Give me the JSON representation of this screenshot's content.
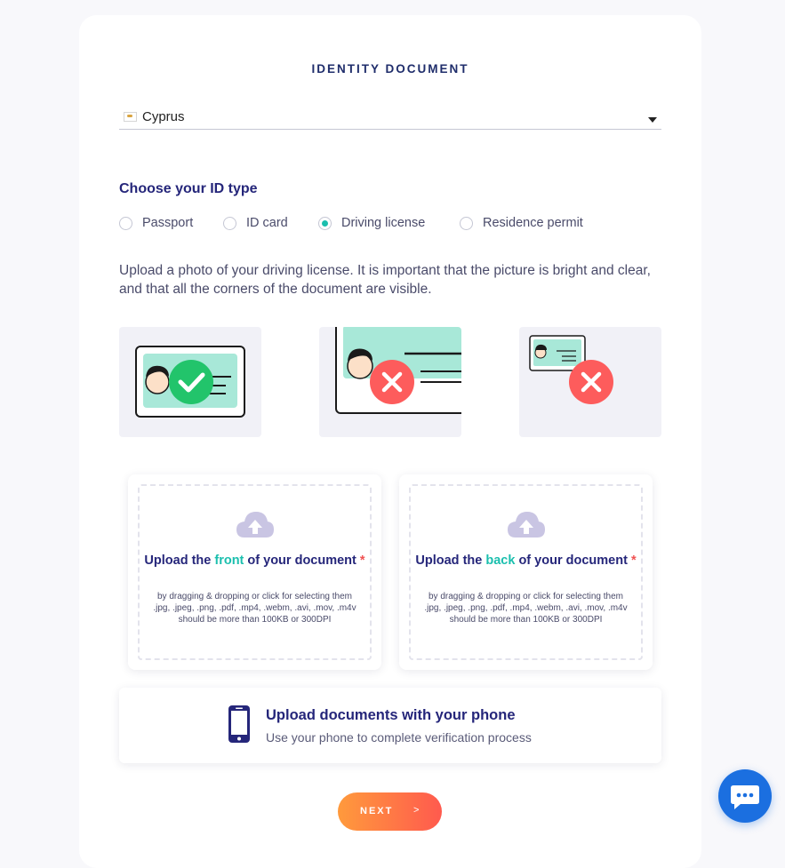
{
  "page": {
    "title": "IDENTITY DOCUMENT",
    "country": {
      "selected": "Cyprus"
    },
    "id_type": {
      "heading": "Choose your ID type",
      "options": [
        {
          "label": "Passport",
          "selected": false
        },
        {
          "label": "ID card",
          "selected": false
        },
        {
          "label": "Driving license",
          "selected": true
        },
        {
          "label": "Residence permit",
          "selected": false
        }
      ]
    },
    "instructions": "Upload a photo of your driving license. It is important that the picture is bright and clear, and that all the corners of the document are visible.",
    "examples": [
      {
        "status": "good",
        "icon": "checkmark-icon"
      },
      {
        "status": "bad",
        "icon": "cross-icon"
      },
      {
        "status": "bad",
        "icon": "cross-icon"
      }
    ],
    "upload_front": {
      "pre": "Upload the ",
      "highlight": "front",
      "post": " of your document",
      "required_mark": "*",
      "help": "by dragging & dropping or click for selecting them",
      "formats": ".jpg, .jpeg, .png, .pdf, .mp4, .webm, .avi, .mov, .m4v",
      "size_note": "should be more than 100KB or 300DPI"
    },
    "upload_back": {
      "pre": "Upload the ",
      "highlight": "back",
      "post": " of your document",
      "required_mark": "*",
      "help": "by dragging & dropping or click for selecting them",
      "formats": ".jpg, .jpeg, .png, .pdf, .mp4, .webm, .avi, .mov, .m4v",
      "size_note": "should be more than 100KB or 300DPI"
    },
    "phone_upload": {
      "title": "Upload documents with your phone",
      "subtitle": "Use your phone to complete verification process"
    },
    "next_button": {
      "label": "NEXT",
      "arrow": ">"
    }
  },
  "colors": {
    "accent_teal": "#1bbfae",
    "navy": "#25267a",
    "error_red": "#f05252",
    "button_gradient_start": "#ff9a3c",
    "button_gradient_end": "#ff5a4e",
    "chat_blue": "#1b6fe0"
  }
}
